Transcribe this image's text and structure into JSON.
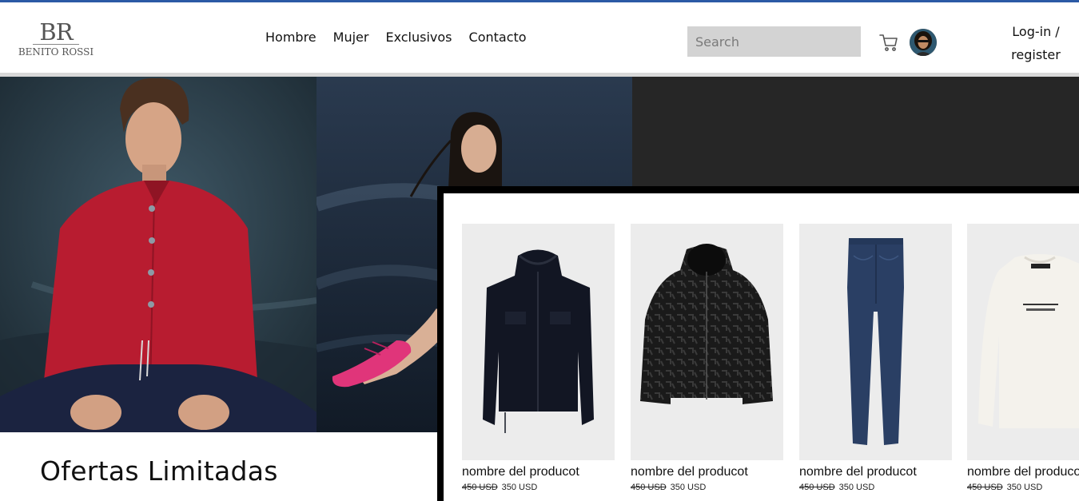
{
  "brand": {
    "monogram": "BR",
    "name": "BENITO ROSSI"
  },
  "nav": [
    {
      "label": "Hombre"
    },
    {
      "label": "Mujer"
    },
    {
      "label": "Exclusivos"
    },
    {
      "label": "Contacto"
    }
  ],
  "search": {
    "placeholder": "Search"
  },
  "auth": {
    "line1": "Log-in /",
    "line2": "register"
  },
  "icons": {
    "cart": "cart-icon",
    "avatar": "user-avatar"
  },
  "offers": {
    "title": "Ofertas Limitadas"
  },
  "products": [
    {
      "name": "nombre del producot",
      "old_price": "450 USD",
      "price": "350 USD",
      "image": "black-hooded-jacket"
    },
    {
      "name": "nombre del producot",
      "old_price": "450 USD",
      "price": "350 USD",
      "image": "black-logo-print-parka"
    },
    {
      "name": "nombre del producot",
      "old_price": "450 USD",
      "price": "350 USD",
      "image": "blue-skinny-jeans"
    },
    {
      "name": "nombre del producot",
      "old_price": "450 USD",
      "price": "350 USD",
      "image": "white-sweatshirt"
    }
  ],
  "colors": {
    "accent_line": "#2b5aa5",
    "search_bg": "#d3d3d3",
    "product_bg": "#ececec",
    "hero_dark": "#262626"
  }
}
